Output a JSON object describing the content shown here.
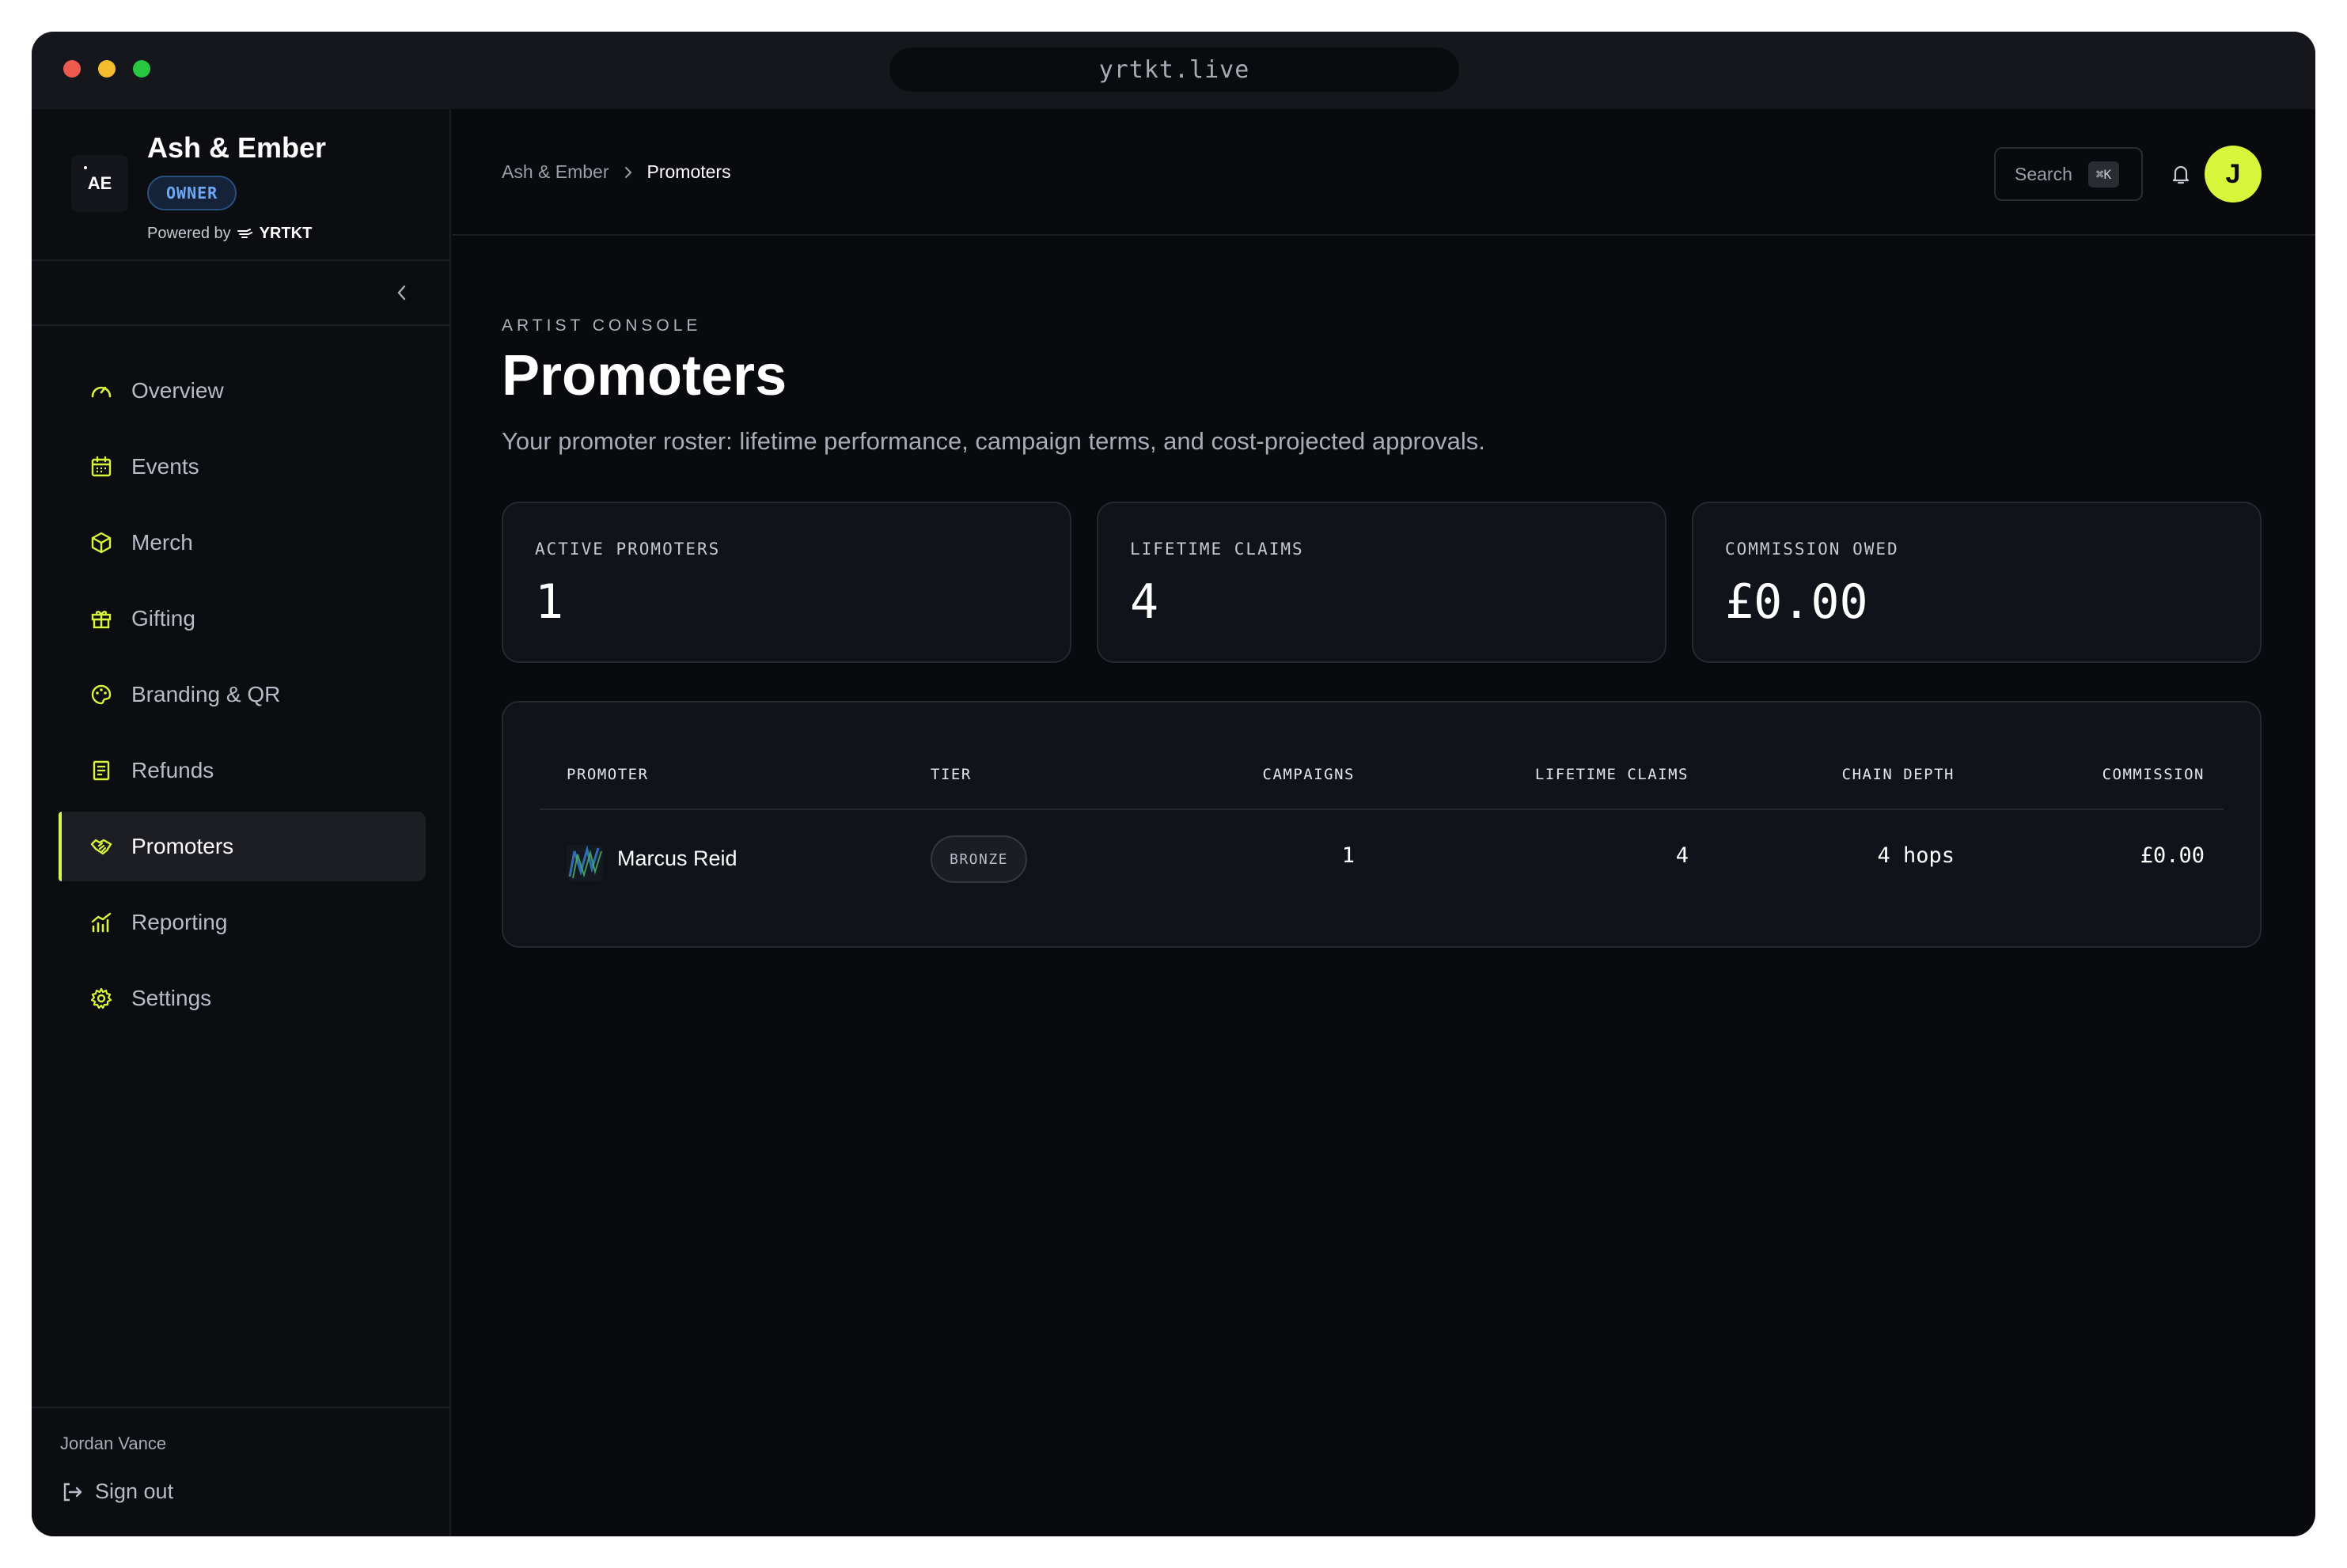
{
  "browser": {
    "url": "yrtkt.live"
  },
  "sidebar": {
    "brand_name": "Ash & Ember",
    "logo_text": "AE",
    "role_badge": "OWNER",
    "powered_by": "Powered by",
    "powered_brand": "YRTKT",
    "items": [
      {
        "label": "Overview",
        "icon": "gauge-icon"
      },
      {
        "label": "Events",
        "icon": "calendar-icon"
      },
      {
        "label": "Merch",
        "icon": "box-icon"
      },
      {
        "label": "Gifting",
        "icon": "gift-icon"
      },
      {
        "label": "Branding & QR",
        "icon": "palette-icon"
      },
      {
        "label": "Refunds",
        "icon": "receipt-icon"
      },
      {
        "label": "Promoters",
        "icon": "handshake-icon",
        "active": true
      },
      {
        "label": "Reporting",
        "icon": "chart-icon"
      },
      {
        "label": "Settings",
        "icon": "gear-icon"
      }
    ],
    "user_name": "Jordan Vance",
    "sign_out": "Sign out"
  },
  "header": {
    "breadcrumb": [
      "Ash & Ember",
      "Promoters"
    ],
    "search_label": "Search",
    "search_shortcut": "⌘K",
    "avatar_initial": "J"
  },
  "page": {
    "eyebrow": "ARTIST CONSOLE",
    "title": "Promoters",
    "subtitle": "Your promoter roster: lifetime performance, campaign terms, and cost-projected approvals."
  },
  "stats": [
    {
      "label": "ACTIVE PROMOTERS",
      "value": "1"
    },
    {
      "label": "LIFETIME CLAIMS",
      "value": "4"
    },
    {
      "label": "COMMISSION OWED",
      "value": "£0.00"
    }
  ],
  "table": {
    "columns": [
      "PROMOTER",
      "TIER",
      "CAMPAIGNS",
      "LIFETIME CLAIMS",
      "CHAIN DEPTH",
      "COMMISSION"
    ],
    "rows": [
      {
        "promoter": "Marcus Reid",
        "tier": "BRONZE",
        "campaigns": "1",
        "lifetime_claims": "4",
        "chain_depth": "4 hops",
        "commission": "£0.00"
      }
    ]
  },
  "colors": {
    "accent": "#d6f53b",
    "background": "#090a0e",
    "card": "#11131a",
    "badge_blue": "#6fa8f5"
  }
}
